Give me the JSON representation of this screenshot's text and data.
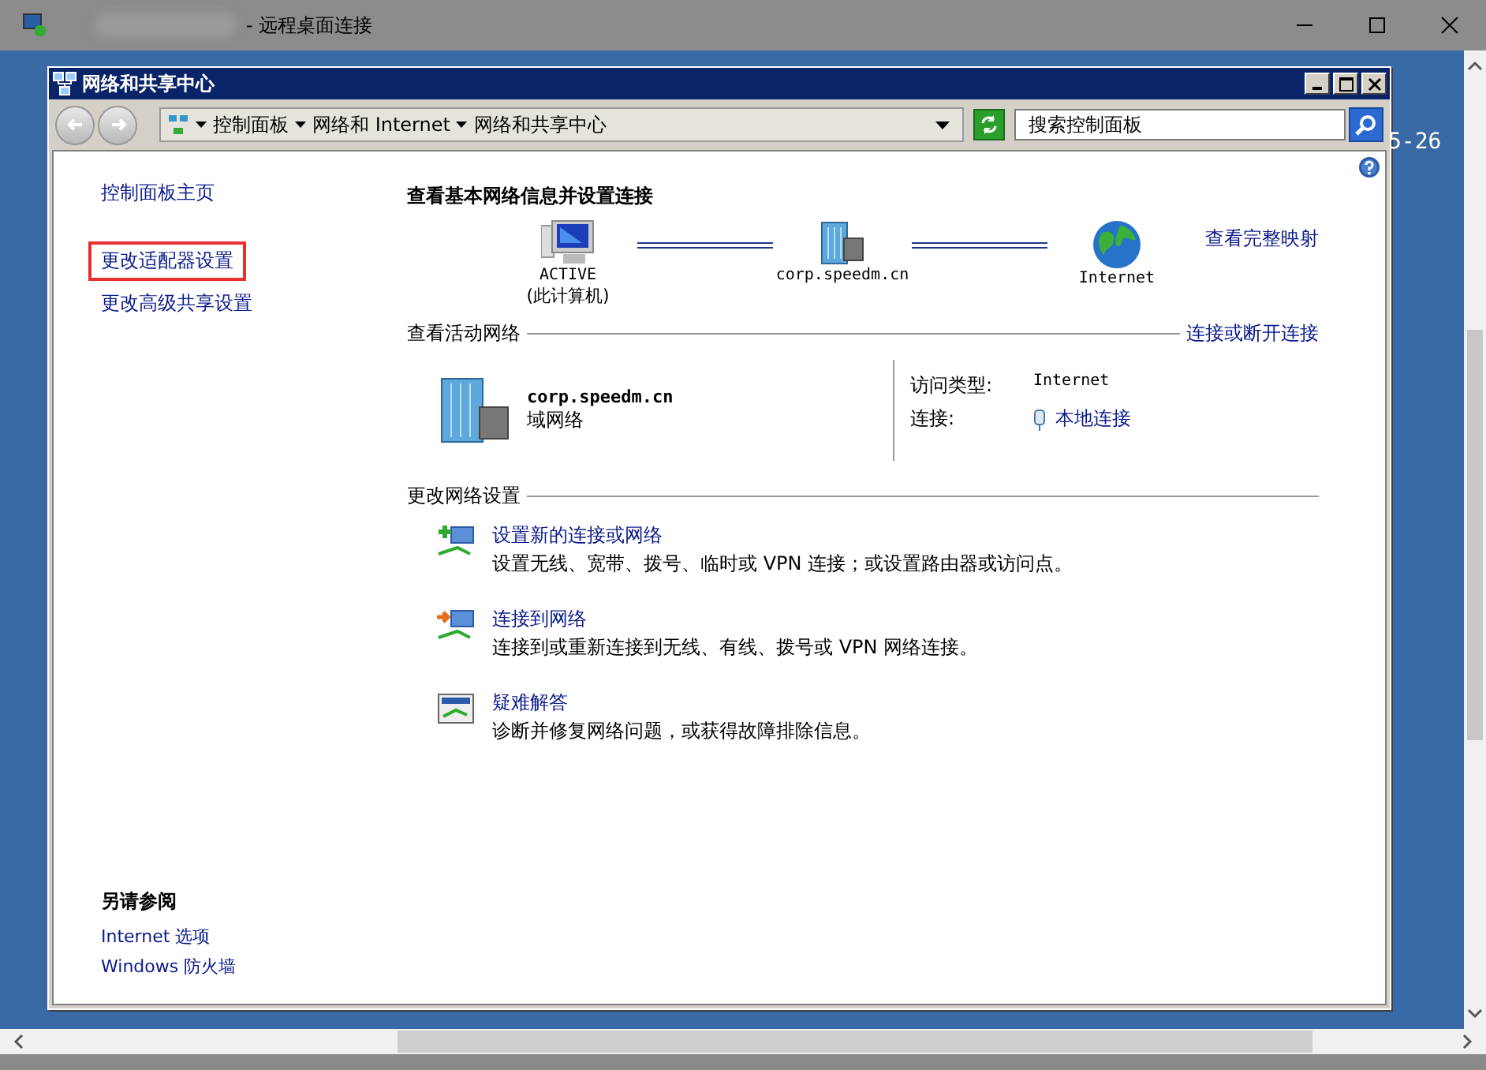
{
  "rdp_window": {
    "title": "- 远程桌面连接"
  },
  "remote_desktop": {
    "background_text": "5-26"
  },
  "window": {
    "title": "网络和共享中心"
  },
  "address_bar": {
    "breadcrumbs": [
      "控制面板",
      "网络和 Internet",
      "网络和共享中心"
    ]
  },
  "search": {
    "placeholder": "搜索控制面板"
  },
  "sidebar": {
    "items": [
      {
        "label": "控制面板主页",
        "highlighted": false
      },
      {
        "label": "更改适配器设置",
        "highlighted": true
      },
      {
        "label": "更改高级共享设置",
        "highlighted": false
      }
    ],
    "see_also": {
      "title": "另请参阅",
      "links": [
        "Internet 选项",
        "Windows 防火墙"
      ]
    }
  },
  "main": {
    "heading": "查看基本网络信息并设置连接",
    "full_map_link": "查看完整映射",
    "map_nodes": [
      {
        "kind": "computer",
        "label": "ACTIVE",
        "sublabel": "(此计算机)"
      },
      {
        "kind": "domain",
        "label": "corp.speedm.cn"
      },
      {
        "kind": "internet",
        "label": "Internet"
      }
    ],
    "active_networks": {
      "title": "查看活动网络",
      "action_link": "连接或断开连接",
      "network_name": "corp.speedm.cn",
      "network_type": "域网络",
      "access_type_label": "访问类型:",
      "access_type": "Internet",
      "connection_label": "连接:",
      "connection": "本地连接"
    },
    "change_settings": {
      "title": "更改网络设置",
      "tasks": [
        {
          "kind": "new",
          "title": "设置新的连接或网络",
          "description": "设置无线、宽带、拨号、临时或 VPN 连接；或设置路由器或访问点。"
        },
        {
          "kind": "connect",
          "title": "连接到网络",
          "description": "连接到或重新连接到无线、有线、拨号或 VPN 网络连接。"
        },
        {
          "kind": "troubleshoot",
          "title": "疑难解答",
          "description": "诊断并修复网络问题，或获得故障排除信息。"
        }
      ]
    }
  }
}
